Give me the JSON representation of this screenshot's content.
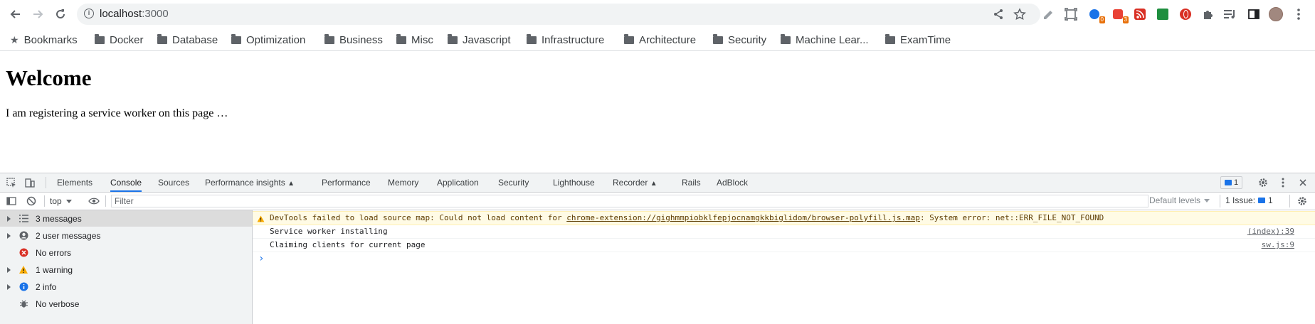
{
  "browser": {
    "url_host": "localhost",
    "url_port": ":3000",
    "extension_badges": [
      "0",
      "3"
    ]
  },
  "bookmarks": [
    {
      "label": "Bookmarks",
      "icon": "star-icon"
    },
    {
      "label": "Docker",
      "icon": "folder-icon"
    },
    {
      "label": "Database",
      "icon": "folder-icon"
    },
    {
      "label": "Optimization",
      "icon": "folder-icon"
    },
    {
      "label": "Business",
      "icon": "folder-icon"
    },
    {
      "label": "Misc",
      "icon": "folder-icon"
    },
    {
      "label": "Javascript",
      "icon": "folder-icon"
    },
    {
      "label": "Infrastructure",
      "icon": "folder-icon"
    },
    {
      "label": "Architecture",
      "icon": "folder-icon"
    },
    {
      "label": "Security",
      "icon": "folder-icon"
    },
    {
      "label": "Machine Lear...",
      "icon": "folder-icon"
    },
    {
      "label": "ExamTime",
      "icon": "folder-icon"
    }
  ],
  "page": {
    "heading": "Welcome",
    "paragraph": "I am registering a service worker on this page …"
  },
  "devtools": {
    "tabs": [
      "Elements",
      "Console",
      "Sources",
      "Performance insights",
      "Performance",
      "Memory",
      "Application",
      "Security",
      "Lighthouse",
      "Recorder",
      "Rails",
      "AdBlock"
    ],
    "active_tab": "Console",
    "issues_count": "1",
    "context": "top",
    "filter_placeholder": "Filter",
    "levels": "Default levels",
    "issues_label": "1 Issue:",
    "issues_badge": "1",
    "sidebar": [
      {
        "label": "3 messages",
        "icon": "list-icon"
      },
      {
        "label": "2 user messages",
        "icon": "user-icon"
      },
      {
        "label": "No errors",
        "icon": "error-icon"
      },
      {
        "label": "1 warning",
        "icon": "warning-icon"
      },
      {
        "label": "2 info",
        "icon": "info-icon"
      },
      {
        "label": "No verbose",
        "icon": "bug-icon"
      }
    ],
    "messages": {
      "warning_prefix": "DevTools failed to load source map: Could not load content for ",
      "warning_link": "chrome-extension://gighmmpiobklfepjocnamgkkbiglidom/browser-polyfill.js.map",
      "warning_suffix": ": System error: net::ERR_FILE_NOT_FOUND",
      "log1": "Service worker installing",
      "log1_src": "(index):39",
      "log2": "Claiming clients for current page",
      "log2_src": "sw.js:9",
      "prompt": "›"
    }
  },
  "colors": {
    "accent": "#1a73e8",
    "warning_bg": "#fffbe5",
    "error": "#d93025",
    "warning": "#f9ab00",
    "info": "#1a73e8"
  }
}
